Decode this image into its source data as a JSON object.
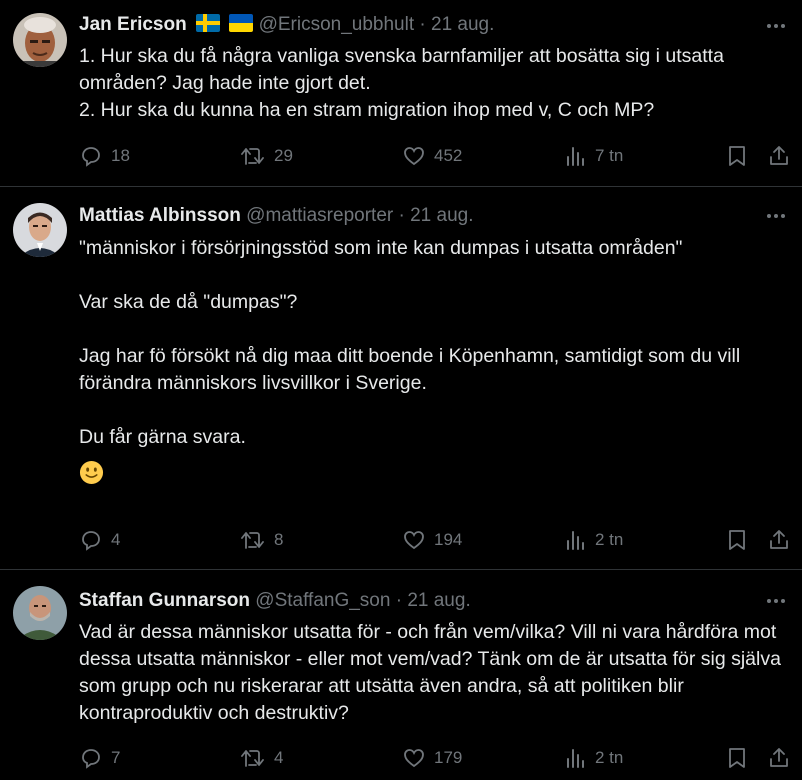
{
  "colors": {
    "background": "#000000",
    "primary_text": "#e7e9ea",
    "secondary_text": "#71767b",
    "divider": "#2f3336"
  },
  "tweets": [
    {
      "name": "Jan Ericson",
      "flags": [
        "sweden-flag",
        "ukraine-flag"
      ],
      "handle": "@Ericson_ubbhult",
      "sep": "·",
      "date": "21 aug.",
      "lines": [
        "1. Hur ska du få några vanliga svenska barnfamiljer att bosätta sig i utsatta områden? Jag hade inte gjort det.",
        "2. Hur ska du kunna ha en stram migration ihop med v, C och MP?"
      ],
      "replies": "18",
      "retweets": "29",
      "likes": "452",
      "views": "7 tn"
    },
    {
      "name": "Mattias Albinsson",
      "handle": "@mattiasreporter",
      "sep": "·",
      "date": "21 aug.",
      "paragraphs": [
        "\"människor i försörjningsstöd som inte kan dumpas i utsatta områden\"",
        "Var ska de då \"dumpas\"?",
        "Jag har fö försökt nå dig maa ditt boende i Köpenhamn, samtidigt som du vill förändra människors livsvillkor i Sverige.",
        "Du får gärna svara."
      ],
      "emoji": "slightly-smiling-face-emoji",
      "replies": "4",
      "retweets": "8",
      "likes": "194",
      "views": "2 tn"
    },
    {
      "name": "Staffan Gunnarson",
      "handle": "@StaffanG_son",
      "sep": "·",
      "date": "21 aug.",
      "text": "Vad är dessa människor utsatta för - och från vem/vilka? Vill ni vara hårdföra mot dessa utsatta människor - eller mot vem/vad? Tänk om de är utsatta för sig själva som grupp och nu riskerarar att utsätta även andra, så att politiken blir kontraproduktiv och destruktiv?",
      "replies": "7",
      "retweets": "4",
      "likes": "179",
      "views": "2 tn"
    }
  ]
}
